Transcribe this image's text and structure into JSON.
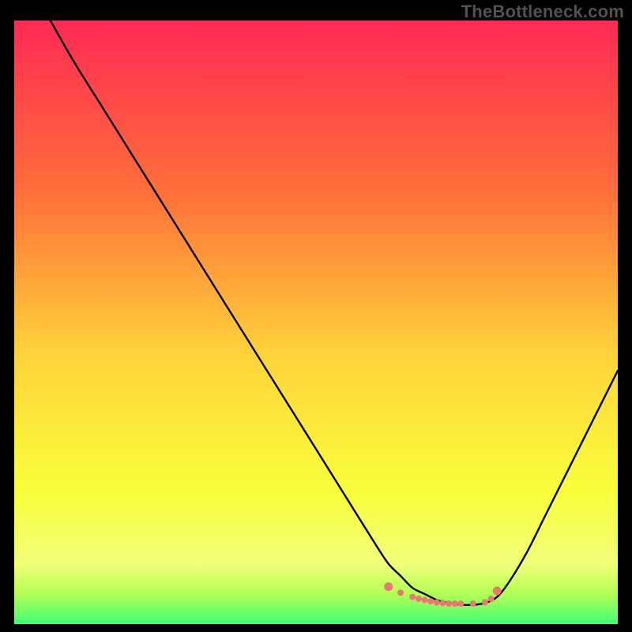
{
  "watermark": "TheBottleneck.com",
  "colors": {
    "gradient_top": "#ff2a55",
    "gradient_upper_mid": "#ff6e3a",
    "gradient_mid": "#ffd23a",
    "gradient_lower_mid": "#f8ff3a",
    "gradient_low": "#f2ff7a",
    "gradient_green1": "#b2ff55",
    "gradient_green2": "#3fff77",
    "curve": "#000000",
    "dots": "#e47a72",
    "frame": "#000000"
  },
  "chart_data": {
    "type": "line",
    "title": "",
    "xlabel": "",
    "ylabel": "",
    "xlim": [
      0,
      100
    ],
    "ylim": [
      0,
      100
    ],
    "series": [
      {
        "name": "curve",
        "x": [
          6,
          10,
          15,
          20,
          25,
          30,
          35,
          40,
          45,
          50,
          55,
          60,
          62,
          64,
          66,
          68,
          70,
          72,
          74,
          76,
          78,
          80,
          82,
          85,
          88,
          92,
          96,
          100
        ],
        "y": [
          100,
          93,
          85,
          77,
          69,
          61,
          53,
          45,
          37,
          29,
          21,
          13,
          10,
          8,
          6,
          5,
          4,
          3.5,
          3.2,
          3.2,
          3.5,
          4.5,
          7,
          12,
          18,
          26,
          34,
          42
        ]
      }
    ],
    "highlight_points": {
      "name": "dots",
      "x": [
        62,
        64,
        66,
        67,
        68,
        69,
        70,
        71,
        72,
        73,
        74,
        76,
        78,
        79,
        80
      ],
      "y": [
        6.2,
        5.2,
        4.5,
        4.2,
        4.0,
        3.8,
        3.6,
        3.5,
        3.4,
        3.4,
        3.4,
        3.4,
        3.6,
        4.2,
        5.5
      ]
    }
  }
}
